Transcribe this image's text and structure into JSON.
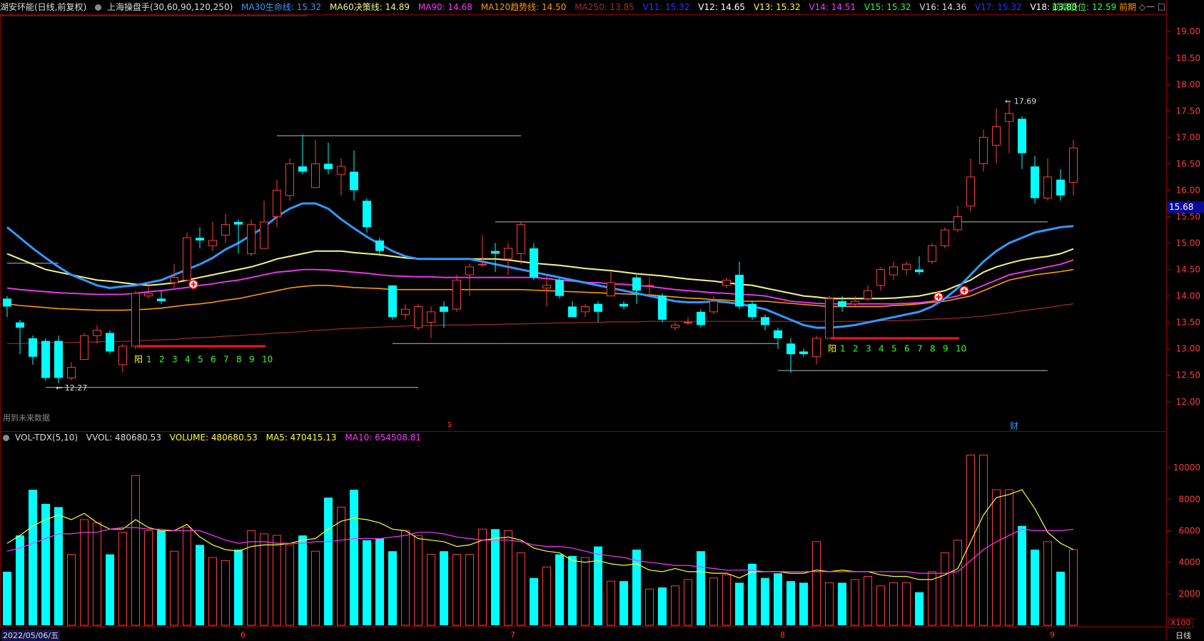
{
  "header": {
    "stock": "湖安环能(日线,前复权)",
    "indicator": "上海操盘手(30,60,90,120,250)",
    "ma30": "MA30生命线: 15.32",
    "ma60": "MA60决策线: 14.89",
    "ma90": "MA90: 14.68",
    "ma120": "MA120趋势线: 14.50",
    "ma250": "MA250: 13.85",
    "v11": "V11: 15.32",
    "v12": "V12: 14.65",
    "v13": "V13: 15.32",
    "v14": "V14: 14.51",
    "v15": "V15: 15.32",
    "v16": "V16: 14.36",
    "v17": "V17: 15.32",
    "v18": "V18: 13.80",
    "prev_low": "前期低位: 12.59",
    "prev_short": "前期",
    "diamond": "◇",
    "min_icon": "—",
    "max_icon": "□"
  },
  "vol_header": {
    "name": "VOL-TDX(5,10)",
    "vvol": "VVOL: 480680.53",
    "volume": "VOLUME: 480680.53",
    "ma5": "MA5: 470415.13",
    "ma10": "MA10: 654508.81"
  },
  "footer": {
    "date": "2022/05/06/五",
    "period": "日线",
    "future_note": "用到未来数据",
    "x100": "X100",
    "fin_mark": "财",
    "s_mark": "S"
  },
  "colors": {
    "up": "#ff3b3b",
    "down": "#00ffff",
    "ma30": "#3399ff",
    "ma60": "#f5f58a",
    "ma90": "#ff33ff",
    "ma120": "#ff9900",
    "ma250": "#a52a2a",
    "frame": "#8b0000"
  },
  "chart_data": [
    {
      "type": "candlestick",
      "price_ylim": [
        11.7,
        19.3
      ],
      "price_ticks": [
        "19.00",
        "18.50",
        "18.00",
        "17.50",
        "17.00",
        "16.50",
        "16.00",
        "15.50",
        "15.00",
        "14.50",
        "14.00",
        "13.50",
        "13.00",
        "12.50",
        "12.00"
      ],
      "current_price": "15.68",
      "month_labels": [
        "6",
        "7",
        "8",
        "9"
      ],
      "month_index": [
        18,
        39,
        60,
        81
      ],
      "candles": [
        [
          13.95,
          13.8,
          14.0,
          13.6
        ],
        [
          13.5,
          13.4,
          13.55,
          12.9
        ],
        [
          13.2,
          12.85,
          13.25,
          12.7
        ],
        [
          13.15,
          12.45,
          13.2,
          12.4
        ],
        [
          13.15,
          12.45,
          13.25,
          12.35
        ],
        [
          12.45,
          12.65,
          12.75,
          12.4
        ],
        [
          12.8,
          13.25,
          13.3,
          12.8
        ],
        [
          13.25,
          13.35,
          13.45,
          13.1
        ],
        [
          13.3,
          12.95,
          13.35,
          12.9
        ],
        [
          12.7,
          13.05,
          13.1,
          12.55
        ],
        [
          13.05,
          14.05,
          14.1,
          13.0
        ],
        [
          14.0,
          14.05,
          14.25,
          13.95
        ],
        [
          13.95,
          13.9,
          14.1,
          13.85
        ],
        [
          14.25,
          14.35,
          14.6,
          14.15
        ],
        [
          14.3,
          15.1,
          15.2,
          14.3
        ],
        [
          15.1,
          15.05,
          15.3,
          14.9
        ],
        [
          14.95,
          15.05,
          15.4,
          14.85
        ],
        [
          15.15,
          15.35,
          15.55,
          15.0
        ],
        [
          15.4,
          15.35,
          15.45,
          14.8
        ],
        [
          14.8,
          15.35,
          15.45,
          14.75
        ],
        [
          14.9,
          15.4,
          15.8,
          14.9
        ],
        [
          15.5,
          16.0,
          16.2,
          15.3
        ],
        [
          15.9,
          16.5,
          16.6,
          15.8
        ],
        [
          16.45,
          16.35,
          17.05,
          16.3
        ],
        [
          16.05,
          16.5,
          16.95,
          16.05
        ],
        [
          16.5,
          16.4,
          16.9,
          16.3
        ],
        [
          16.3,
          16.45,
          16.6,
          15.9
        ],
        [
          16.35,
          16.0,
          16.75,
          15.8
        ],
        [
          15.8,
          15.3,
          15.85,
          15.2
        ],
        [
          15.05,
          14.85,
          15.1,
          14.75
        ],
        [
          14.2,
          13.6,
          14.2,
          13.55
        ],
        [
          13.65,
          13.75,
          13.85,
          13.55
        ],
        [
          13.4,
          13.8,
          13.85,
          13.35
        ],
        [
          13.5,
          13.7,
          13.8,
          13.2
        ],
        [
          13.8,
          13.7,
          13.9,
          13.4
        ],
        [
          13.75,
          14.3,
          14.4,
          13.7
        ],
        [
          14.4,
          14.55,
          14.6,
          14.0
        ],
        [
          14.6,
          14.6,
          15.15,
          14.55
        ],
        [
          14.85,
          14.8,
          15.0,
          14.45
        ],
        [
          14.7,
          14.9,
          15.0,
          14.4
        ],
        [
          14.8,
          15.35,
          15.4,
          14.6
        ],
        [
          14.9,
          14.35,
          15.0,
          14.3
        ],
        [
          14.15,
          14.2,
          14.4,
          13.8
        ],
        [
          14.3,
          14.0,
          14.35,
          13.95
        ],
        [
          13.8,
          13.6,
          13.9,
          13.6
        ],
        [
          13.7,
          13.8,
          13.85,
          13.6
        ],
        [
          13.85,
          13.7,
          13.9,
          13.5
        ],
        [
          14.0,
          14.25,
          14.45,
          14.0
        ],
        [
          13.85,
          13.8,
          13.9,
          13.75
        ],
        [
          14.35,
          14.1,
          14.4,
          13.85
        ],
        [
          14.2,
          14.2,
          14.35,
          14.0
        ],
        [
          14.0,
          13.55,
          14.05,
          13.5
        ],
        [
          13.4,
          13.45,
          13.5,
          13.35
        ],
        [
          13.5,
          13.5,
          13.6,
          13.45
        ],
        [
          13.7,
          13.45,
          13.75,
          13.4
        ],
        [
          13.7,
          13.9,
          14.0,
          13.65
        ],
        [
          14.2,
          14.3,
          14.35,
          14.15
        ],
        [
          14.4,
          13.8,
          14.65,
          13.75
        ],
        [
          13.85,
          13.6,
          13.9,
          13.55
        ],
        [
          13.6,
          13.45,
          13.65,
          13.35
        ],
        [
          13.35,
          13.2,
          13.4,
          13.0
        ],
        [
          13.1,
          12.9,
          13.2,
          12.55
        ],
        [
          12.95,
          12.9,
          13.0,
          12.85
        ],
        [
          12.85,
          13.2,
          13.25,
          12.7
        ],
        [
          13.2,
          13.95,
          14.0,
          13.2
        ],
        [
          13.9,
          13.8,
          14.0,
          13.7
        ],
        [
          13.85,
          13.9,
          14.0,
          13.8
        ],
        [
          13.95,
          14.1,
          14.2,
          13.9
        ],
        [
          14.2,
          14.5,
          14.55,
          14.1
        ],
        [
          14.4,
          14.55,
          14.65,
          14.3
        ],
        [
          14.5,
          14.6,
          14.65,
          14.4
        ],
        [
          14.5,
          14.45,
          14.75,
          14.4
        ],
        [
          14.65,
          14.95,
          15.0,
          14.6
        ],
        [
          14.95,
          15.25,
          15.3,
          14.9
        ],
        [
          15.25,
          15.5,
          15.7,
          15.2
        ],
        [
          15.7,
          16.25,
          16.6,
          15.6
        ],
        [
          16.5,
          17.0,
          17.15,
          16.35
        ],
        [
          16.85,
          17.2,
          17.55,
          16.5
        ],
        [
          17.3,
          17.45,
          17.7,
          16.7
        ],
        [
          17.35,
          16.7,
          17.4,
          16.4
        ],
        [
          16.45,
          15.85,
          16.65,
          15.75
        ],
        [
          15.85,
          16.25,
          16.6,
          15.8
        ],
        [
          16.2,
          15.9,
          16.4,
          15.8
        ],
        [
          16.15,
          16.8,
          16.95,
          15.9
        ]
      ],
      "ma30": [
        15.3,
        15.1,
        14.9,
        14.72,
        14.55,
        14.4,
        14.3,
        14.2,
        14.15,
        14.18,
        14.2,
        14.25,
        14.3,
        14.4,
        14.5,
        14.6,
        14.72,
        14.88,
        15.0,
        15.15,
        15.3,
        15.5,
        15.65,
        15.75,
        15.75,
        15.65,
        15.45,
        15.28,
        15.12,
        14.98,
        14.85,
        14.75,
        14.7,
        14.7,
        14.7,
        14.7,
        14.7,
        14.65,
        14.6,
        14.55,
        14.5,
        14.45,
        14.4,
        14.35,
        14.3,
        14.25,
        14.2,
        14.15,
        14.1,
        14.05,
        14.0,
        13.95,
        13.9,
        13.88,
        13.88,
        13.9,
        13.88,
        13.85,
        13.8,
        13.75,
        13.65,
        13.55,
        13.45,
        13.4,
        13.4,
        13.42,
        13.45,
        13.5,
        13.55,
        13.6,
        13.65,
        13.7,
        13.8,
        13.95,
        14.15,
        14.4,
        14.65,
        14.85,
        15.0,
        15.1,
        15.2,
        15.25,
        15.3,
        15.32
      ],
      "ma60": [
        14.8,
        14.7,
        14.6,
        14.5,
        14.45,
        14.4,
        14.35,
        14.3,
        14.28,
        14.25,
        14.22,
        14.2,
        14.22,
        14.25,
        14.3,
        14.35,
        14.4,
        14.45,
        14.5,
        14.55,
        14.62,
        14.7,
        14.75,
        14.8,
        14.85,
        14.85,
        14.85,
        14.82,
        14.8,
        14.78,
        14.75,
        14.72,
        14.7,
        14.7,
        14.7,
        14.7,
        14.7,
        14.7,
        14.7,
        14.68,
        14.65,
        14.62,
        14.6,
        14.58,
        14.55,
        14.52,
        14.5,
        14.48,
        14.45,
        14.42,
        14.4,
        14.38,
        14.35,
        14.32,
        14.3,
        14.28,
        14.25,
        14.22,
        14.2,
        14.15,
        14.1,
        14.05,
        14.0,
        13.98,
        13.95,
        13.95,
        13.95,
        13.95,
        13.95,
        13.96,
        13.98,
        14.0,
        14.05,
        14.1,
        14.2,
        14.3,
        14.45,
        14.55,
        14.62,
        14.68,
        14.72,
        14.75,
        14.8,
        14.89
      ],
      "ma90": [
        14.15,
        14.12,
        14.1,
        14.08,
        14.06,
        14.05,
        14.04,
        14.03,
        14.03,
        14.03,
        14.05,
        14.08,
        14.1,
        14.13,
        14.16,
        14.2,
        14.23,
        14.27,
        14.3,
        14.35,
        14.4,
        14.45,
        14.47,
        14.5,
        14.5,
        14.49,
        14.47,
        14.45,
        14.43,
        14.4,
        14.38,
        14.37,
        14.36,
        14.36,
        14.35,
        14.35,
        14.35,
        14.35,
        14.35,
        14.35,
        14.35,
        14.35,
        14.33,
        14.3,
        14.28,
        14.26,
        14.25,
        14.23,
        14.22,
        14.2,
        14.18,
        14.15,
        14.12,
        14.1,
        14.08,
        14.06,
        14.05,
        14.03,
        14.02,
        14.0,
        13.95,
        13.9,
        13.88,
        13.86,
        13.85,
        13.85,
        13.85,
        13.85,
        13.85,
        13.85,
        13.86,
        13.87,
        13.9,
        13.95,
        14.0,
        14.1,
        14.2,
        14.3,
        14.4,
        14.45,
        14.5,
        14.55,
        14.6,
        14.68
      ],
      "ma120": [
        13.85,
        13.82,
        13.8,
        13.78,
        13.76,
        13.75,
        13.74,
        13.73,
        13.73,
        13.73,
        13.74,
        13.75,
        13.77,
        13.8,
        13.83,
        13.85,
        13.88,
        13.92,
        13.95,
        14.0,
        14.05,
        14.1,
        14.15,
        14.18,
        14.2,
        14.2,
        14.18,
        14.16,
        14.15,
        14.14,
        14.12,
        14.12,
        14.12,
        14.12,
        14.12,
        14.12,
        14.12,
        14.12,
        14.12,
        14.12,
        14.12,
        14.11,
        14.1,
        14.09,
        14.08,
        14.07,
        14.06,
        14.05,
        14.04,
        14.03,
        14.02,
        14.0,
        13.98,
        13.96,
        13.95,
        13.93,
        13.92,
        13.9,
        13.9,
        13.9,
        13.88,
        13.86,
        13.84,
        13.82,
        13.8,
        13.8,
        13.8,
        13.8,
        13.8,
        13.82,
        13.83,
        13.85,
        13.88,
        13.9,
        13.95,
        14.0,
        14.1,
        14.2,
        14.3,
        14.35,
        14.4,
        14.43,
        14.46,
        14.5
      ],
      "ma250": [
        13.1,
        13.1,
        13.11,
        13.11,
        13.12,
        13.12,
        13.13,
        13.13,
        13.14,
        13.14,
        13.15,
        13.16,
        13.17,
        13.18,
        13.2,
        13.21,
        13.22,
        13.24,
        13.25,
        13.27,
        13.28,
        13.3,
        13.31,
        13.33,
        13.35,
        13.36,
        13.38,
        13.39,
        13.4,
        13.41,
        13.42,
        13.43,
        13.44,
        13.44,
        13.45,
        13.45,
        13.45,
        13.46,
        13.46,
        13.47,
        13.47,
        13.48,
        13.48,
        13.49,
        13.49,
        13.5,
        13.5,
        13.51,
        13.51,
        13.51,
        13.52,
        13.52,
        13.52,
        13.52,
        13.52,
        13.52,
        13.52,
        13.52,
        13.52,
        13.52,
        13.52,
        13.52,
        13.52,
        13.52,
        13.52,
        13.52,
        13.52,
        13.52,
        13.53,
        13.53,
        13.54,
        13.55,
        13.56,
        13.57,
        13.58,
        13.6,
        13.62,
        13.65,
        13.68,
        13.72,
        13.75,
        13.78,
        13.82,
        13.85
      ],
      "annotations": {
        "low_label": "← 12.27",
        "high_label": "← 17.69",
        "yang_label": "阳",
        "count_labels": [
          "1",
          "2",
          "3",
          "4",
          "5",
          "6",
          "7",
          "8",
          "9",
          "10"
        ]
      },
      "volume_ylim": [
        0,
        11500
      ],
      "volume_ticks": [
        "10000",
        "8000",
        "6000",
        "4000",
        "2000"
      ],
      "volume": [
        3400,
        5700,
        8600,
        7700,
        7500,
        4500,
        6700,
        6500,
        4500,
        5900,
        9500,
        6000,
        6000,
        4700,
        6200,
        5100,
        4300,
        4100,
        4800,
        6000,
        5800,
        5700,
        5100,
        5700,
        4700,
        8100,
        7500,
        8600,
        5400,
        5500,
        4700,
        6000,
        5700,
        4500,
        4700,
        4500,
        4500,
        6100,
        6100,
        6000,
        4600,
        3000,
        3700,
        4500,
        4400,
        4300,
        5000,
        2800,
        2800,
        4800,
        2300,
        2400,
        2500,
        2900,
        4700,
        3000,
        3200,
        2700,
        3900,
        3000,
        3300,
        2800,
        2700,
        5300,
        2700,
        2700,
        2900,
        3100,
        2500,
        2700,
        2700,
        2100,
        3400,
        4600,
        5400,
        10800,
        10800,
        8600,
        8600,
        6300,
        4800,
        5300,
        3400,
        4800
      ],
      "vol_ma5": [
        5200,
        5700,
        6300,
        6700,
        7000,
        6700,
        7100,
        6500,
        6100,
        6100,
        6700,
        6200,
        6000,
        6000,
        6400,
        5600,
        5100,
        4800,
        4700,
        5000,
        5100,
        5100,
        5200,
        5400,
        5500,
        6100,
        6600,
        6800,
        6700,
        6500,
        6100,
        6000,
        5500,
        5400,
        5300,
        5000,
        5100,
        5400,
        5500,
        5600,
        5400,
        4900,
        4700,
        4600,
        4100,
        4000,
        4100,
        3900,
        3800,
        3900,
        3500,
        3400,
        3600,
        3400,
        3400,
        3300,
        3300,
        3000,
        3400,
        3400,
        3400,
        3300,
        3300,
        3500,
        3400,
        3500,
        3400,
        3400,
        3200,
        3100,
        3100,
        2900,
        2900,
        3200,
        3600,
        5300,
        7000,
        8100,
        8300,
        8600,
        7400,
        5900,
        5200,
        4800
      ],
      "vol_ma10": [
        4700,
        4900,
        5200,
        5500,
        5800,
        5800,
        5900,
        5900,
        6100,
        6200,
        6200,
        6100,
        6100,
        6000,
        6000,
        6000,
        5700,
        5400,
        5200,
        5300,
        5300,
        5200,
        5200,
        5200,
        5300,
        5300,
        5400,
        5500,
        5500,
        5500,
        5600,
        5700,
        5900,
        5900,
        5800,
        5600,
        5500,
        5400,
        5400,
        5400,
        5300,
        5100,
        5000,
        5000,
        4900,
        4700,
        4500,
        4400,
        4300,
        4100,
        4000,
        3900,
        3800,
        3800,
        3700,
        3600,
        3500,
        3500,
        3500,
        3400,
        3400,
        3400,
        3400,
        3400,
        3400,
        3400,
        3400,
        3400,
        3400,
        3400,
        3400,
        3300,
        3300,
        3300,
        3400,
        4100,
        4800,
        5300,
        5700,
        6100,
        6000,
        6000,
        6000,
        6100
      ]
    }
  ]
}
